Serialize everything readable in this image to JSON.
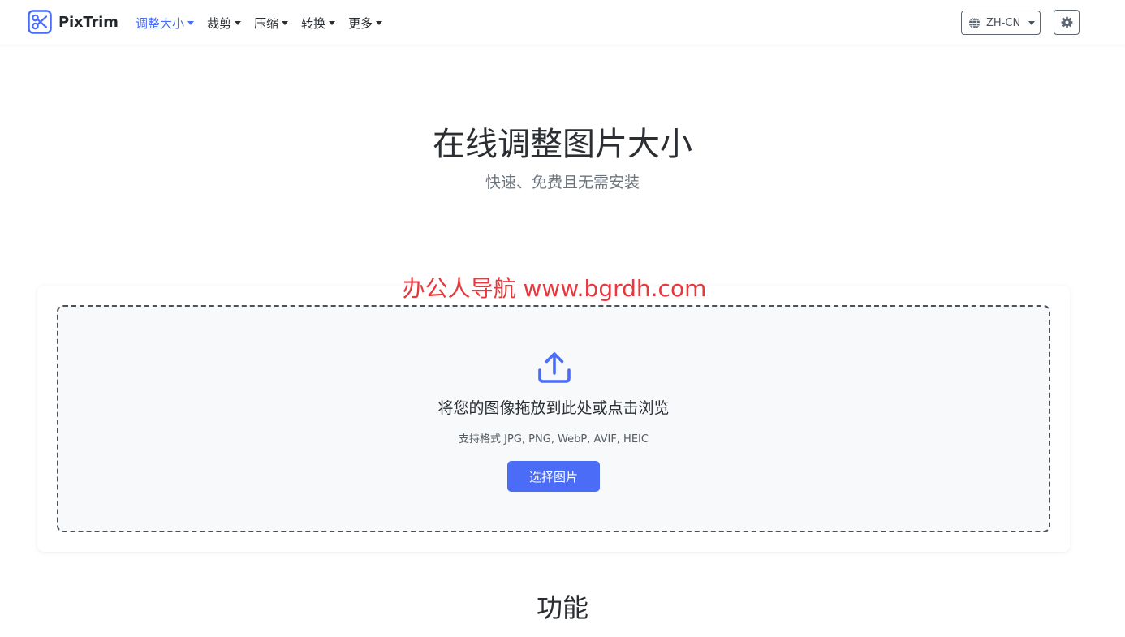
{
  "brand": {
    "name": "PixTrim"
  },
  "nav": {
    "items": [
      {
        "label": "调整大小",
        "active": true
      },
      {
        "label": "裁剪",
        "active": false
      },
      {
        "label": "压缩",
        "active": false
      },
      {
        "label": "转换",
        "active": false
      },
      {
        "label": "更多",
        "active": false
      }
    ]
  },
  "language": {
    "selected": "ZH-CN"
  },
  "hero": {
    "title": "在线调整图片大小",
    "subtitle": "快速、免费且无需安装"
  },
  "watermark": "办公人导航  www.bgrdh.com",
  "upload": {
    "drop_text": "将您的图像拖放到此处或点击浏览",
    "formats_text": "支持格式 JPG, PNG, WebP, AVIF, HEIC",
    "button_label": "选择图片"
  },
  "features": {
    "title": "功能"
  },
  "colors": {
    "accent": "#4a6cf7",
    "watermark": "#e8383d",
    "text": "#2b2f33",
    "muted": "#6c757d"
  },
  "icons": {
    "logo": "scissors-icon",
    "language": "globe-icon",
    "settings": "gear-icon",
    "upload": "upload-icon"
  }
}
